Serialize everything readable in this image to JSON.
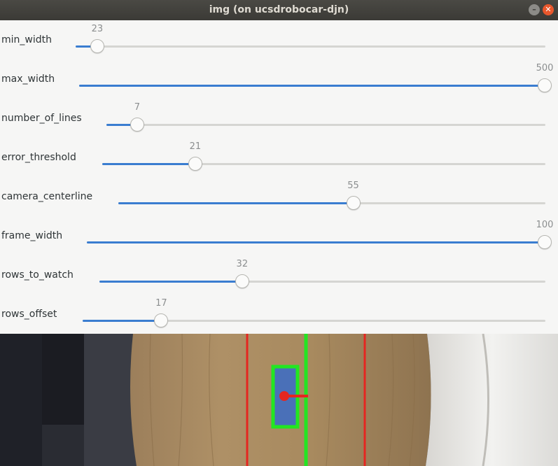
{
  "window": {
    "title": "img (on ucsdrobocar-djn)",
    "minimize_icon": "minimize-icon",
    "close_icon": "close-icon"
  },
  "sliders": [
    {
      "label": "min_width",
      "value": "23",
      "fraction": 0.046
    },
    {
      "label": "max_width",
      "value": "500",
      "fraction": 1.0
    },
    {
      "label": "number_of_lines",
      "value": "7",
      "fraction": 0.07
    },
    {
      "label": "error_threshold",
      "value": "21",
      "fraction": 0.21
    },
    {
      "label": "camera_centerline",
      "value": "55",
      "fraction": 0.55
    },
    {
      "label": "frame_width",
      "value": "100",
      "fraction": 1.0
    },
    {
      "label": "rows_to_watch",
      "value": "32",
      "fraction": 0.32
    },
    {
      "label": "rows_offset",
      "value": "17",
      "fraction": 0.17
    }
  ],
  "colors": {
    "accent": "#3a7dd0",
    "lane_line": "#e52620",
    "detection_box": "#22e622",
    "centroid": "#e52620"
  }
}
